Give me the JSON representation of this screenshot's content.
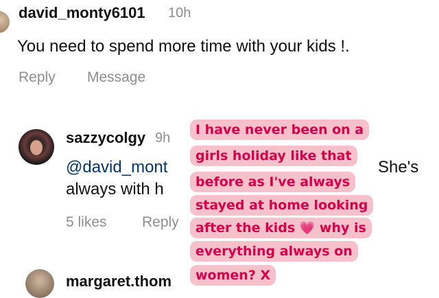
{
  "comment1": {
    "username": "david_monty6101",
    "time": "10h",
    "text": "You need to spend more time with your kids !.",
    "reply": "Reply",
    "message": "Message"
  },
  "comment2": {
    "username": "sazzycolgy",
    "time": "9h",
    "mention": "@david_mont",
    "text_continued": "She's",
    "text_line2": "always with h",
    "likes": "5 likes",
    "reply": "Reply"
  },
  "comment3": {
    "username": "margaret.thom"
  },
  "overlay": {
    "lines": [
      "I have never been on a",
      "girls holiday like that",
      "before as I've always",
      "stayed at home looking",
      "after the kids",
      "why is",
      "everything always on",
      "women? X"
    ],
    "heart_icon": "pink-heart-icon",
    "background": "#f7c1cc",
    "text_color": "#d6004b"
  }
}
